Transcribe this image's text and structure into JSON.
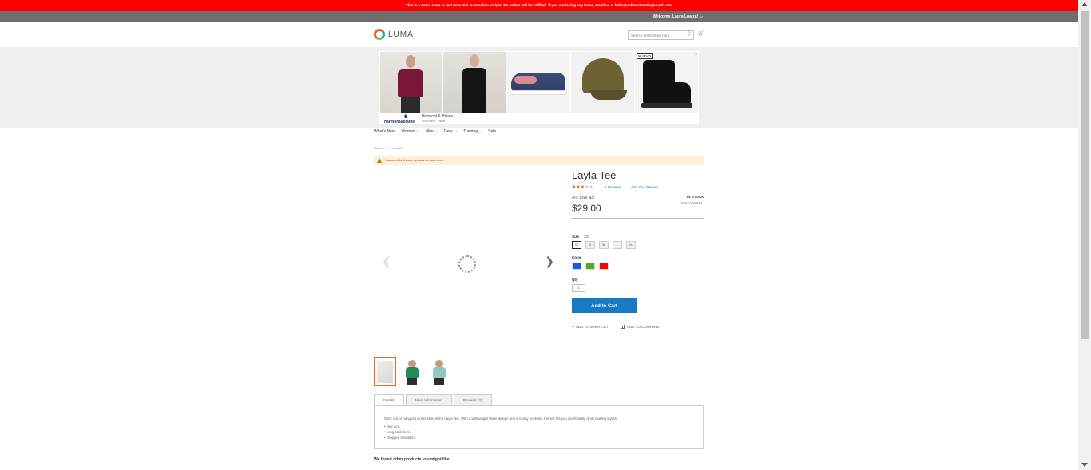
{
  "demo_notice": "This is a demo store to test your test automation scripts. No orders will be fulfilled. If you are facing any issue, email us at hello@softwaretestingboard.com.",
  "header": {
    "welcome": "Welcome, Laura Loaiza!",
    "logo_text": "LUMA",
    "search_placeholder": "Search entire store here..."
  },
  "ad": {
    "badge": "NUEVO",
    "close": "×",
    "brand_logo": "harmont&blaine",
    "brand_name": "Harmont & Blaine",
    "brand_sub": "Anunciado · Visitar"
  },
  "nav": [
    {
      "label": "What's New"
    },
    {
      "label": "Women ⌵"
    },
    {
      "label": "Men ⌵"
    },
    {
      "label": "Gear ⌵"
    },
    {
      "label": "Training ⌵"
    },
    {
      "label": "Sale"
    }
  ],
  "breadcrumb": {
    "home": "Home",
    "separator": ">",
    "current": "Layla Tee"
  },
  "notice": "You need to choose options for your item.",
  "product": {
    "title": "Layla Tee",
    "rating_stars_on": "★★★",
    "rating_stars_off": "★★",
    "rating_percent": 60,
    "reviews_link": "2  Reviews",
    "add_review": "Add Your Review",
    "as_low_as": "As low as",
    "price": "$29.00",
    "stock": "IN STOCK",
    "sku": "SKU#:  WS04"
  },
  "options": {
    "size_label": "Size",
    "size_selected": "XS",
    "sizes": [
      "XS",
      "S",
      "M",
      "L",
      "XL"
    ],
    "color_label": "Color",
    "colors": [
      "#1857f7",
      "#53a828",
      "#ff0000"
    ],
    "qty_label": "Qty",
    "qty_value": "1"
  },
  "actions": {
    "add_to_cart": "Add to Cart",
    "wishlist": "ADD TO WISH LIST",
    "compare": "ADD TO COMPARE"
  },
  "thumbs": [
    {
      "name": "image-placeholder"
    },
    {
      "name": "green-tee",
      "color": "#1f8a5b"
    },
    {
      "name": "mint-tee",
      "color": "#8fc8c2"
    }
  ],
  "tabs": [
    {
      "label": "Details"
    },
    {
      "label": "More Information"
    },
    {
      "label": "Reviews (2)"
    }
  ],
  "details": {
    "description": "Work out or hang out in this style in the Layla Tee. With a lightweight sheer design and a roomy neckline, this tee fits you comfortably while looking stylish.",
    "bullets": [
      "• Tear ace.",
      "• Long back hem.",
      "• Dropped shoulders."
    ]
  },
  "other_products": "We found other products you might like!"
}
